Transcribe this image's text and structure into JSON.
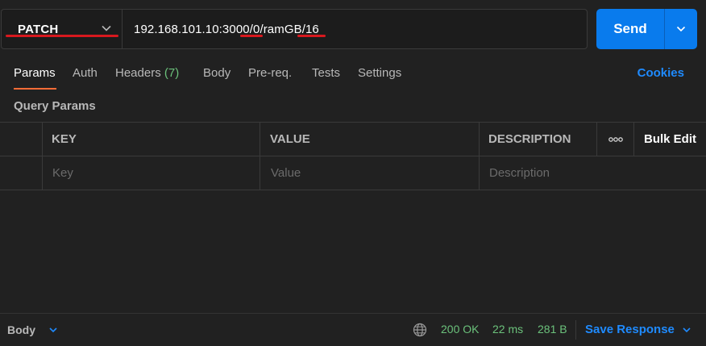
{
  "request": {
    "method": "PATCH",
    "url": {
      "part1": "192.168.101.10:3000/",
      "part2": "0",
      "part3": "/ramGB/",
      "part4": "16"
    },
    "send_label": "Send"
  },
  "tabs": {
    "params": "Params",
    "auth": "Auth",
    "headers": "Headers",
    "headers_count": "(7)",
    "body": "Body",
    "prereq": "Pre-req.",
    "tests": "Tests",
    "settings": "Settings",
    "cookies": "Cookies"
  },
  "query_params": {
    "title": "Query Params",
    "columns": {
      "key": "KEY",
      "value": "VALUE",
      "description": "DESCRIPTION",
      "more": "ooo",
      "bulk_edit": "Bulk Edit"
    },
    "placeholders": {
      "key": "Key",
      "value": "Value",
      "description": "Description"
    }
  },
  "status_bar": {
    "body_label": "Body",
    "status": "200 OK",
    "time": "22 ms",
    "size": "281 B",
    "save_response": "Save Response"
  },
  "colors": {
    "accent": "#ff6c37",
    "send": "#097bed",
    "link": "#1f8bff",
    "success": "#6bc17b",
    "annotation": "#d8181e"
  }
}
